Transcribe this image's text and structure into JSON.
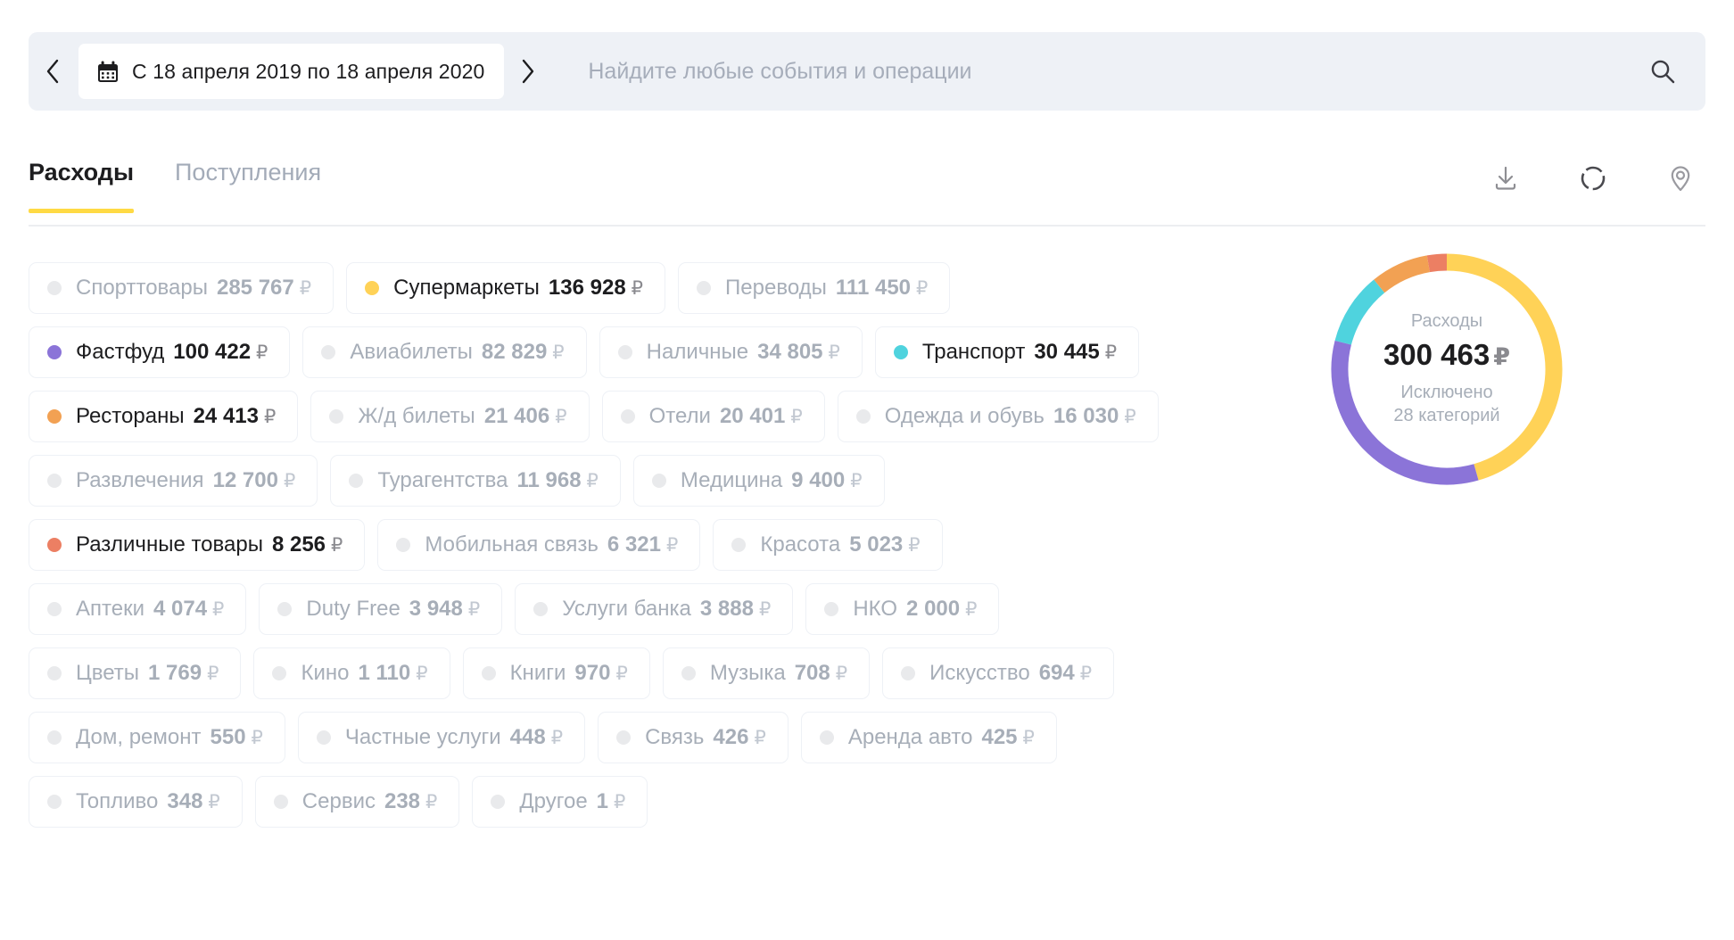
{
  "searchbar": {
    "prev_label": "‹",
    "next_label": "›",
    "date_range": "С 18 апреля 2019 по 18 апреля 2020",
    "search_placeholder": "Найдите любые события и операции",
    "search_value": ""
  },
  "tabs": {
    "items": [
      {
        "label": "Расходы",
        "active": true
      },
      {
        "label": "Поступления",
        "active": false
      }
    ],
    "actions": [
      {
        "name": "download-icon"
      },
      {
        "name": "donut-chart-icon"
      },
      {
        "name": "map-pin-icon"
      }
    ]
  },
  "currency": "₽",
  "categories": [
    {
      "name": "Спорттовары",
      "amount": "285 767",
      "value": 285767,
      "active": false,
      "color": "#e9eaec"
    },
    {
      "name": "Супермаркеты",
      "amount": "136 928",
      "value": 136928,
      "active": true,
      "color": "#FFD257"
    },
    {
      "name": "Переводы",
      "amount": "111 450",
      "value": 111450,
      "active": false,
      "color": "#e9eaec"
    },
    {
      "name": "Фастфуд",
      "amount": "100 422",
      "value": 100422,
      "active": true,
      "color": "#8B74D8"
    },
    {
      "name": "Авиабилеты",
      "amount": "82 829",
      "value": 82829,
      "active": false,
      "color": "#e9eaec"
    },
    {
      "name": "Наличные",
      "amount": "34 805",
      "value": 34805,
      "active": false,
      "color": "#e9eaec"
    },
    {
      "name": "Транспорт",
      "amount": "30 445",
      "value": 30445,
      "active": true,
      "color": "#4FD3DE"
    },
    {
      "name": "Рестораны",
      "amount": "24 413",
      "value": 24413,
      "active": true,
      "color": "#F2A153"
    },
    {
      "name": "Ж/д билеты",
      "amount": "21 406",
      "value": 21406,
      "active": false,
      "color": "#e9eaec"
    },
    {
      "name": "Отели",
      "amount": "20 401",
      "value": 20401,
      "active": false,
      "color": "#e9eaec"
    },
    {
      "name": "Одежда и обувь",
      "amount": "16 030",
      "value": 16030,
      "active": false,
      "color": "#e9eaec"
    },
    {
      "name": "Развлечения",
      "amount": "12 700",
      "value": 12700,
      "active": false,
      "color": "#e9eaec"
    },
    {
      "name": "Турагентства",
      "amount": "11 968",
      "value": 11968,
      "active": false,
      "color": "#e9eaec"
    },
    {
      "name": "Медицина",
      "amount": "9 400",
      "value": 9400,
      "active": false,
      "color": "#e9eaec"
    },
    {
      "name": "Различные товары",
      "amount": "8 256",
      "value": 8256,
      "active": true,
      "color": "#EC7F63"
    },
    {
      "name": "Мобильная связь",
      "amount": "6 321",
      "value": 6321,
      "active": false,
      "color": "#e9eaec"
    },
    {
      "name": "Красота",
      "amount": "5 023",
      "value": 5023,
      "active": false,
      "color": "#e9eaec"
    },
    {
      "name": "Аптеки",
      "amount": "4 074",
      "value": 4074,
      "active": false,
      "color": "#e9eaec"
    },
    {
      "name": "Duty Free",
      "amount": "3 948",
      "value": 3948,
      "active": false,
      "color": "#e9eaec"
    },
    {
      "name": "Услуги банка",
      "amount": "3 888",
      "value": 3888,
      "active": false,
      "color": "#e9eaec"
    },
    {
      "name": "НКО",
      "amount": "2 000",
      "value": 2000,
      "active": false,
      "color": "#e9eaec"
    },
    {
      "name": "Цветы",
      "amount": "1 769",
      "value": 1769,
      "active": false,
      "color": "#e9eaec"
    },
    {
      "name": "Кино",
      "amount": "1 110",
      "value": 1110,
      "active": false,
      "color": "#e9eaec"
    },
    {
      "name": "Книги",
      "amount": "970",
      "value": 970,
      "active": false,
      "color": "#e9eaec"
    },
    {
      "name": "Музыка",
      "amount": "708",
      "value": 708,
      "active": false,
      "color": "#e9eaec"
    },
    {
      "name": "Искусство",
      "amount": "694",
      "value": 694,
      "active": false,
      "color": "#e9eaec"
    },
    {
      "name": "Дом, ремонт",
      "amount": "550",
      "value": 550,
      "active": false,
      "color": "#e9eaec"
    },
    {
      "name": "Частные услуги",
      "amount": "448",
      "value": 448,
      "active": false,
      "color": "#e9eaec"
    },
    {
      "name": "Связь",
      "amount": "426",
      "value": 426,
      "active": false,
      "color": "#e9eaec"
    },
    {
      "name": "Аренда авто",
      "amount": "425",
      "value": 425,
      "active": false,
      "color": "#e9eaec"
    },
    {
      "name": "Топливо",
      "amount": "348",
      "value": 348,
      "active": false,
      "color": "#e9eaec"
    },
    {
      "name": "Сервис",
      "amount": "238",
      "value": 238,
      "active": false,
      "color": "#e9eaec"
    },
    {
      "name": "Другое",
      "amount": "1",
      "value": 1,
      "active": false,
      "color": "#e9eaec"
    }
  ],
  "donut": {
    "center_label": "Расходы",
    "center_amount": "300 463",
    "center_currency": "₽",
    "excluded_line1": "Исключено",
    "excluded_line2": "28 категорий"
  },
  "chart_data": {
    "type": "pie",
    "title": "Расходы",
    "total": 300463,
    "total_label": "300 463 ₽",
    "excluded_note": "Исключено 28 категорий",
    "legend_position": "left-chips",
    "categories": [
      "Супермаркеты",
      "Фастфуд",
      "Транспорт",
      "Рестораны",
      "Различные товары"
    ],
    "values": [
      136928,
      100422,
      30445,
      24413,
      8256
    ],
    "colors": [
      "#FFD257",
      "#8B74D8",
      "#4FD3DE",
      "#F2A153",
      "#EC7F63"
    ],
    "percentages": [
      45.6,
      33.4,
      10.1,
      8.1,
      2.7
    ]
  }
}
